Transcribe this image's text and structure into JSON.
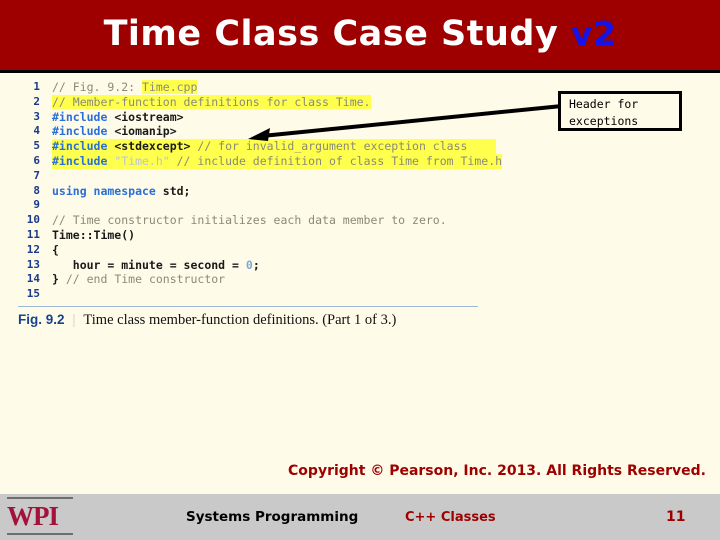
{
  "slide": {
    "title_main": "Time Class Case Study",
    "title_suffix": "v2",
    "title_color": "#ffffff",
    "title_suffix_color": "#1414e6",
    "header_bg": "#9e0000"
  },
  "figure": {
    "caption_number": "Fig. 9.2",
    "caption_text": "Time class member-function definitions. (Part 1 of 3.)",
    "highlight_color": "#ffff4d",
    "code_lines": [
      {
        "n": "1",
        "text": "// Fig. 9.2: Time.cpp"
      },
      {
        "n": "2",
        "text": "// Member-function definitions for class Time."
      },
      {
        "n": "3",
        "text": "#include <iostream>"
      },
      {
        "n": "4",
        "text": "#include <iomanip>"
      },
      {
        "n": "5",
        "text": "#include <stdexcept> // for invalid_argument exception class"
      },
      {
        "n": "6",
        "text": "#include \"Time.h\" // include definition of class Time from Time.h"
      },
      {
        "n": "7",
        "text": ""
      },
      {
        "n": "8",
        "text": "using namespace std;"
      },
      {
        "n": "9",
        "text": ""
      },
      {
        "n": "10",
        "text": "// Time constructor initializes each data member to zero."
      },
      {
        "n": "11",
        "text": "Time::Time()"
      },
      {
        "n": "12",
        "text": "{"
      },
      {
        "n": "13",
        "text": "   hour = minute = second = 0;"
      },
      {
        "n": "14",
        "text": "} // end Time constructor"
      },
      {
        "n": "15",
        "text": ""
      }
    ]
  },
  "callout": {
    "label": "Header for\nexceptions",
    "points_to_line": "5"
  },
  "copyright": {
    "text": "Copyright © Pearson, Inc. 2013. All Rights Reserved.",
    "color": "#9e0000"
  },
  "footer": {
    "logo_text": "WPI",
    "course": "Systems Programming",
    "topic": "C++ Classes",
    "page_number": "11",
    "bar_color": "#c9c9c9"
  }
}
